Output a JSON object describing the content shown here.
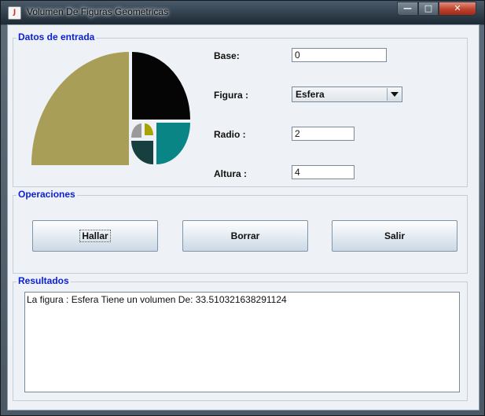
{
  "window": {
    "title": "Volumen De Figuras Geometricas",
    "app_icon": "java-icon",
    "controls": {
      "minimize": "minimize-icon",
      "maximize": "maximize-icon",
      "close": "close-icon"
    }
  },
  "datos_entrada": {
    "title": "Datos de entrada",
    "logo": "golden-spiral-figure",
    "base": {
      "label": "Base:",
      "value": "0"
    },
    "figura": {
      "label": "Figura :",
      "selected": "Esfera"
    },
    "radio": {
      "label": "Radio :",
      "value": "2"
    },
    "altura": {
      "label": "Altura :",
      "value": "4"
    }
  },
  "operaciones": {
    "title": "Operaciones",
    "hallar": "Hallar",
    "borrar": "Borrar",
    "salir": "Salir"
  },
  "resultados": {
    "title": "Resultados",
    "text": "La figura : Esfera Tiene un volumen De: 33.510321638291124"
  },
  "colors": {
    "group_title": "#0a1fd6",
    "logo_olive": "#a89e58",
    "logo_black": "#050505",
    "logo_teal": "#0a8585",
    "logo_dark_teal": "#173f3f",
    "logo_gray": "#9a9a9a",
    "logo_yellow": "#a7a300"
  }
}
